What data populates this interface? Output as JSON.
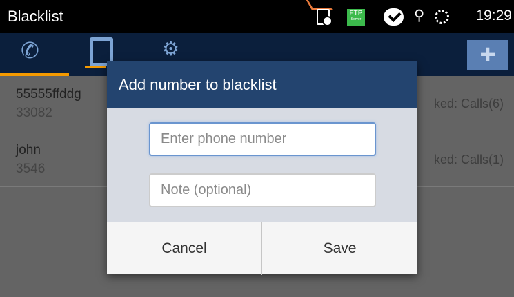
{
  "statusbar": {
    "title": "Blacklist",
    "ftp_label": "FTP",
    "ftp_sub": "Server",
    "time": "19:29"
  },
  "tabs": [
    {
      "icon": "call-log-icon"
    },
    {
      "icon": "contacts-icon"
    },
    {
      "icon": "settings-icon"
    }
  ],
  "add_button": "+",
  "list": [
    {
      "name": "55555ffddg",
      "number": "33082",
      "blocked": "ked: Calls(6)"
    },
    {
      "name": "john",
      "number": "3546",
      "blocked": "ked: Calls(1)"
    }
  ],
  "dialog": {
    "title": "Add number to blacklist",
    "phone_placeholder": "Enter phone number",
    "note_placeholder": "Note (optional)",
    "cancel": "Cancel",
    "save": "Save"
  },
  "colors": {
    "header": "#23446f",
    "tabbar": "#0b1f3c",
    "accent": "#f59a00"
  }
}
